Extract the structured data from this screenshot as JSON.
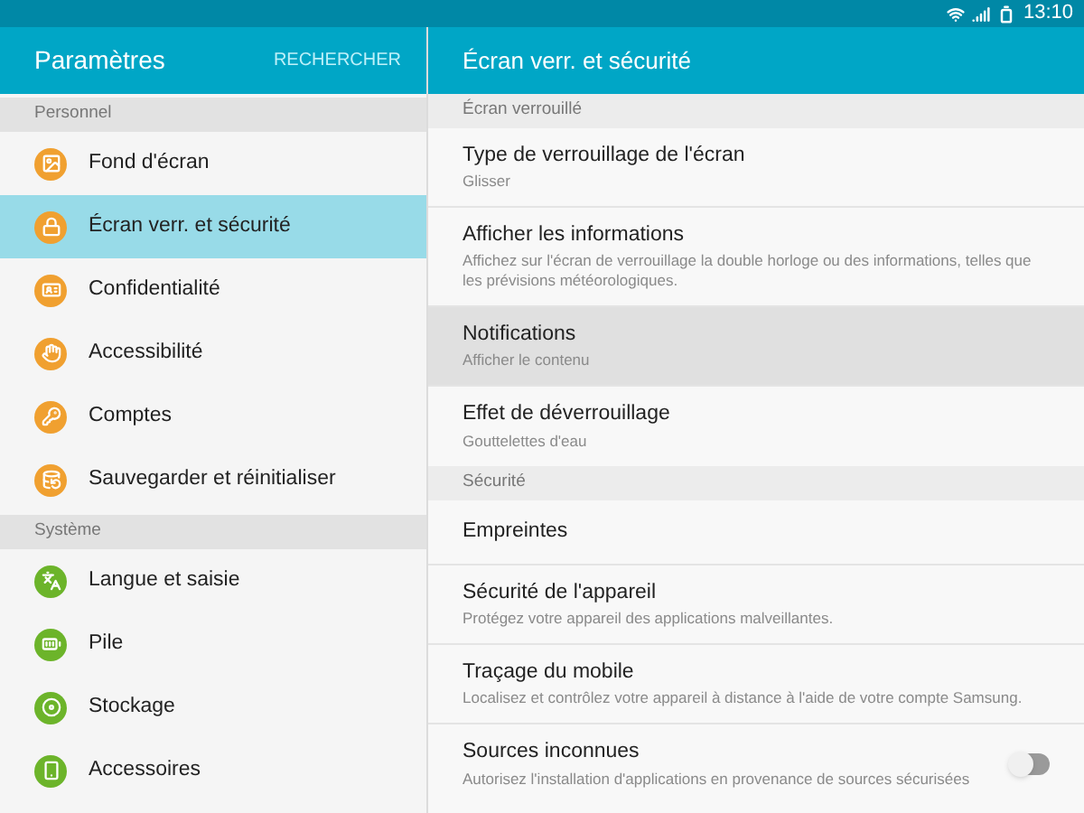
{
  "status_bar": {
    "time": "13:10"
  },
  "sidebar": {
    "title": "Paramètres",
    "search_action": "RECHERCHER",
    "sections": [
      {
        "header": "Personnel",
        "items": [
          {
            "label": "Fond d'écran",
            "selected": false
          },
          {
            "label": "Écran verr. et sécurité",
            "selected": true
          },
          {
            "label": "Confidentialité",
            "selected": false
          },
          {
            "label": "Accessibilité",
            "selected": false
          },
          {
            "label": "Comptes",
            "selected": false
          },
          {
            "label": "Sauvegarder et réinitialiser",
            "selected": false
          }
        ]
      },
      {
        "header": "Système",
        "items": [
          {
            "label": "Langue et saisie",
            "selected": false
          },
          {
            "label": "Pile",
            "selected": false
          },
          {
            "label": "Stockage",
            "selected": false
          },
          {
            "label": "Accessoires",
            "selected": false
          }
        ]
      }
    ]
  },
  "detail": {
    "title": "Écran verr. et sécurité",
    "sections": [
      {
        "header": "Écran verrouillé",
        "items": [
          {
            "kind": "plain",
            "title": "Type de verrouillage de l'écran",
            "subtitle": "Glisser",
            "selected": false
          },
          {
            "kind": "plain",
            "title": "Afficher les informations",
            "subtitle": "Affichez sur l'écran de verrouillage la double horloge ou des informations, telles que les prévisions météorologiques.",
            "selected": false
          },
          {
            "kind": "plain",
            "title": "Notifications",
            "subtitle": "Afficher le contenu",
            "selected": true
          },
          {
            "kind": "plain",
            "title": "Effet de déverrouillage",
            "subtitle": "Gouttelettes d'eau",
            "selected": false
          }
        ]
      },
      {
        "header": "Sécurité",
        "items": [
          {
            "kind": "plain",
            "title": "Empreintes",
            "selected": false
          },
          {
            "kind": "plain",
            "title": "Sécurité de l'appareil",
            "subtitle": "Protégez votre appareil des applications malveillantes.",
            "selected": false
          },
          {
            "kind": "plain",
            "title": "Traçage du mobile",
            "subtitle": "Localisez et contrôlez votre appareil à distance à l'aide de votre compte Samsung.",
            "selected": false
          },
          {
            "kind": "toggle",
            "title": "Sources inconnues",
            "subtitle": "Autorisez l'installation d'applications en provenance de sources sécurisées",
            "on": false,
            "selected": false
          }
        ]
      }
    ]
  }
}
